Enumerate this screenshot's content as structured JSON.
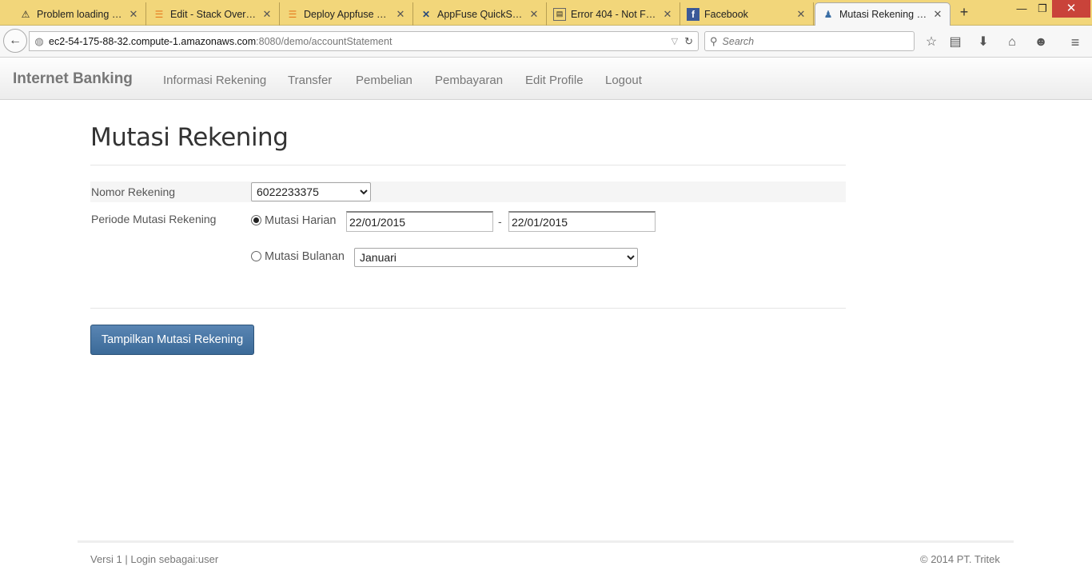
{
  "browser": {
    "tabs": [
      {
        "title": "Problem loading p...",
        "icon": "warning-icon"
      },
      {
        "title": "Edit - Stack Overfl...",
        "icon": "stackoverflow-icon"
      },
      {
        "title": "Deploy Appfuse Sp...",
        "icon": "stackoverflow-icon"
      },
      {
        "title": "AppFuse QuickStar...",
        "icon": "appfuse-icon"
      },
      {
        "title": "Error 404 - Not Fou...",
        "icon": "page-icon"
      },
      {
        "title": "Facebook",
        "icon": "facebook-icon"
      },
      {
        "title": "Mutasi Rekening | I...",
        "icon": "app-icon",
        "active": true
      }
    ],
    "url_host": "ec2-54-175-88-32.compute-1.amazonaws.com",
    "url_path": ":8080/demo/accountStatement",
    "search_placeholder": "Search"
  },
  "app": {
    "brand": "Internet Banking",
    "nav": [
      "Informasi Rekening",
      "Transfer",
      "Pembelian",
      "Pembayaran",
      "Edit Profile",
      "Logout"
    ]
  },
  "main": {
    "title": "Mutasi Rekening",
    "account_label": "Nomor Rekening",
    "account_value": "6022233375",
    "period_label": "Periode Mutasi Rekening",
    "daily_label": "Mutasi Harian",
    "date_from": "22/01/2015",
    "date_separator": "-",
    "date_to": "22/01/2015",
    "monthly_label": "Mutasi Bulanan",
    "month_value": "Januari",
    "submit_label": "Tampilkan Mutasi Rekening"
  },
  "footer": {
    "left": "Versi 1 | Login sebagai:user",
    "right": "© 2014 PT. Tritek"
  }
}
